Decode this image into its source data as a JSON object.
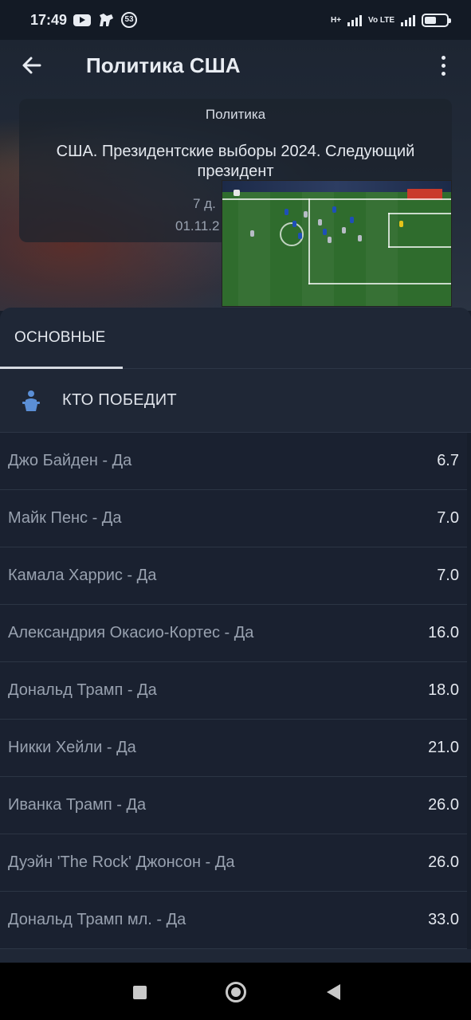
{
  "status_bar": {
    "time": "17:49",
    "notification_count": "53",
    "network_1": "H+",
    "network_2": "Vo LTE"
  },
  "app_bar": {
    "title": "Политика США"
  },
  "event": {
    "category": "Политика",
    "name": "США. Президентские выборы 2024. Следующий президент",
    "countdown": "7 д.",
    "date": "01.11.2"
  },
  "tabs": [
    {
      "label": "ОСНОВНЫЕ",
      "active": true
    }
  ],
  "market": {
    "title": "КТО ПОБЕДИТ",
    "icon": "podium-person-icon"
  },
  "outcomes": [
    {
      "name": "Джо Байден - Да",
      "odds": "6.7"
    },
    {
      "name": "Майк Пенс - Да",
      "odds": "7.0"
    },
    {
      "name": "Камала Харрис - Да",
      "odds": "7.0"
    },
    {
      "name": "Александрия Окасио-Кортес - Да",
      "odds": "16.0"
    },
    {
      "name": "Дональд Трамп - Да",
      "odds": "18.0"
    },
    {
      "name": "Никки Хейли - Да",
      "odds": "21.0"
    },
    {
      "name": "Иванка Трамп - Да",
      "odds": "26.0"
    },
    {
      "name": "Дуэйн 'The Rock' Джонсон - Да",
      "odds": "26.0"
    },
    {
      "name": "Дональд Трамп мл. - Да",
      "odds": "33.0"
    }
  ],
  "colors": {
    "background": "#171e2b",
    "sheet": "#1f2736",
    "accent_icon": "#5b8fd6",
    "outcome_text": "#98a1af",
    "odds_text": "#e2e6ed"
  }
}
